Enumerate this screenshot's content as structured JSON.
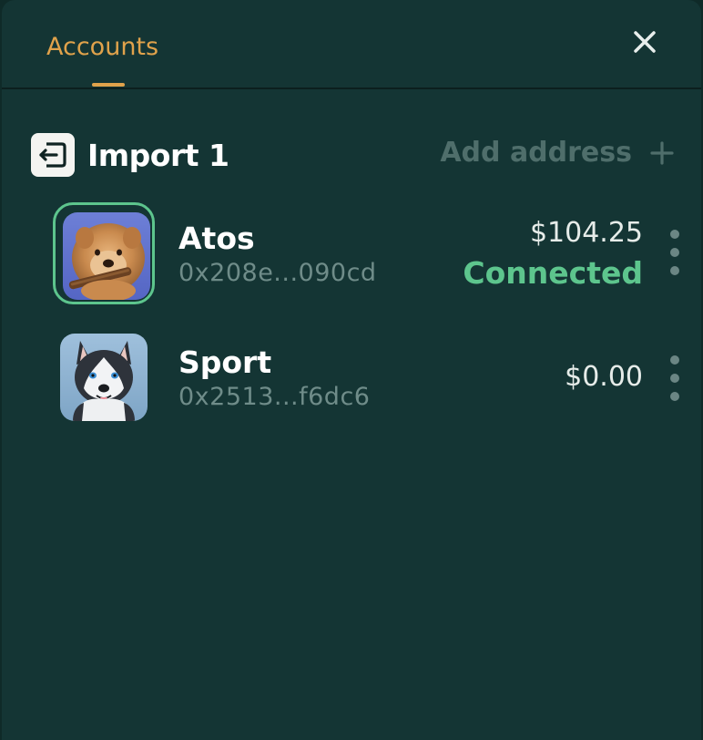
{
  "header": {
    "tab_label": "Accounts",
    "close_icon": "close-icon"
  },
  "wallet": {
    "name": "Import 1",
    "icon": "import-icon",
    "add_address_label": "Add address",
    "add_icon": "plus-icon"
  },
  "accounts": [
    {
      "name": "Atos",
      "address": "0x208e...090cd",
      "balance": "$104.25",
      "status": "Connected",
      "selected": true,
      "avatar": "chow-chow-dog-avatar"
    },
    {
      "name": "Sport",
      "address": "0x2513...f6dc6",
      "balance": "$0.00",
      "status": "",
      "selected": false,
      "avatar": "husky-dog-avatar"
    }
  ],
  "colors": {
    "panel_background": "#143534",
    "accent_orange": "#e0a24b",
    "connected_green": "#5dc58d",
    "muted_text": "#6f8c89"
  }
}
